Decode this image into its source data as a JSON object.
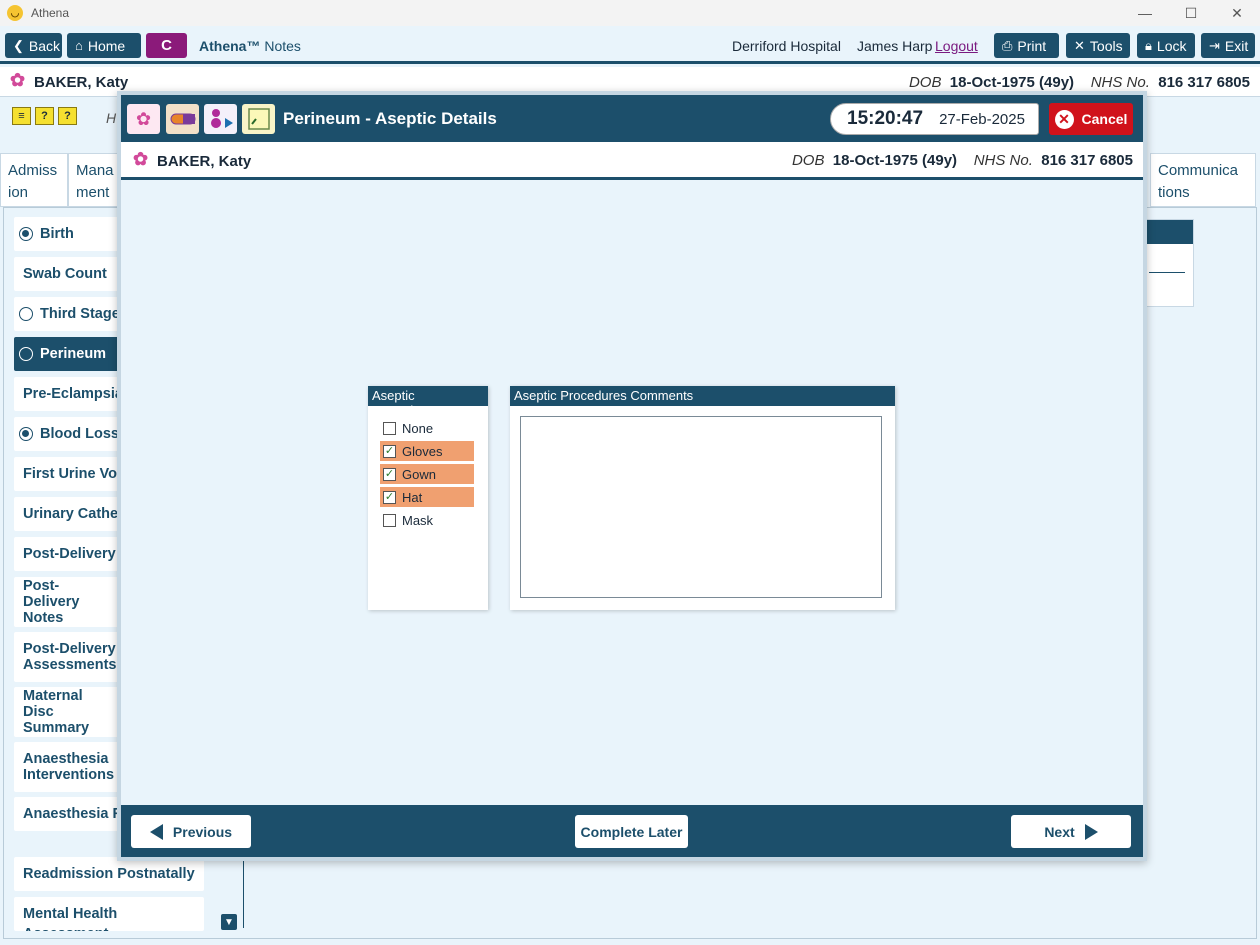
{
  "window": {
    "title": "Athena",
    "minimize": "—",
    "maximize": "☐",
    "close": "✕"
  },
  "toolbar": {
    "back": "Back",
    "home": "Home",
    "c_button": "C",
    "app_name": "Athena™",
    "app_section": "Notes",
    "hospital": "Derriford Hospital",
    "user": "James Harp",
    "logout": "Logout",
    "print": "Print",
    "tools": "Tools",
    "lock": "Lock",
    "exit": "Exit"
  },
  "patient": {
    "name": "BAKER, Katy",
    "dob_label": "DOB",
    "dob": "18-Oct-1975 (49y)",
    "nhs_label": "NHS No.",
    "nhs": "816 317 6805"
  },
  "underlay": {
    "h_label": "H",
    "tabs": [
      {
        "label": "Admiss\nion"
      },
      {
        "label": "Mana\nment"
      },
      {
        "label": "Communica\ntions"
      }
    ]
  },
  "sidenav": [
    {
      "label": "Birth",
      "radio": "filled"
    },
    {
      "label": "Swab Count",
      "radio": "none"
    },
    {
      "label": "Third Stage",
      "radio": "empty"
    },
    {
      "label": "Perineum",
      "radio": "empty",
      "active": true
    },
    {
      "label": "Pre-Eclampsia",
      "radio": "none"
    },
    {
      "label": "Blood Loss",
      "radio": "filled"
    },
    {
      "label": "First Urine Voi",
      "radio": "none"
    },
    {
      "label": "Urinary Cathe",
      "radio": "none"
    },
    {
      "label": "Post-Delivery",
      "radio": "none"
    },
    {
      "label": "Post-Delivery Notes",
      "radio": "none"
    },
    {
      "label": "Post-Delivery Assessments",
      "radio": "none"
    },
    {
      "label": "Maternal Disc Summary",
      "radio": "none"
    },
    {
      "label": "Anaesthesia Interventions",
      "radio": "none"
    },
    {
      "label": "Anaesthesia F",
      "radio": "none"
    },
    {
      "label": "Readmission Postnatally",
      "radio": "none"
    },
    {
      "label": "Mental Health Assessment",
      "radio": "none"
    }
  ],
  "modal": {
    "title": "Perineum - Aseptic Details",
    "time": "15:20:47",
    "date": "27-Feb-2025",
    "cancel": "Cancel",
    "procedures": {
      "header": "Aseptic Procedures",
      "items": [
        {
          "label": "None",
          "checked": false
        },
        {
          "label": "Gloves",
          "checked": true
        },
        {
          "label": "Gown",
          "checked": true
        },
        {
          "label": "Hat",
          "checked": true
        },
        {
          "label": "Mask",
          "checked": false
        }
      ]
    },
    "comments": {
      "header": "Aseptic Procedures Comments",
      "value": ""
    },
    "footer": {
      "previous": "Previous",
      "complete_later": "Complete Later",
      "next": "Next"
    }
  },
  "colors": {
    "primary": "#1c4f6b",
    "checked_highlight": "#f0a070",
    "cancel": "#d0121b",
    "c_button": "#8b1a7a"
  }
}
